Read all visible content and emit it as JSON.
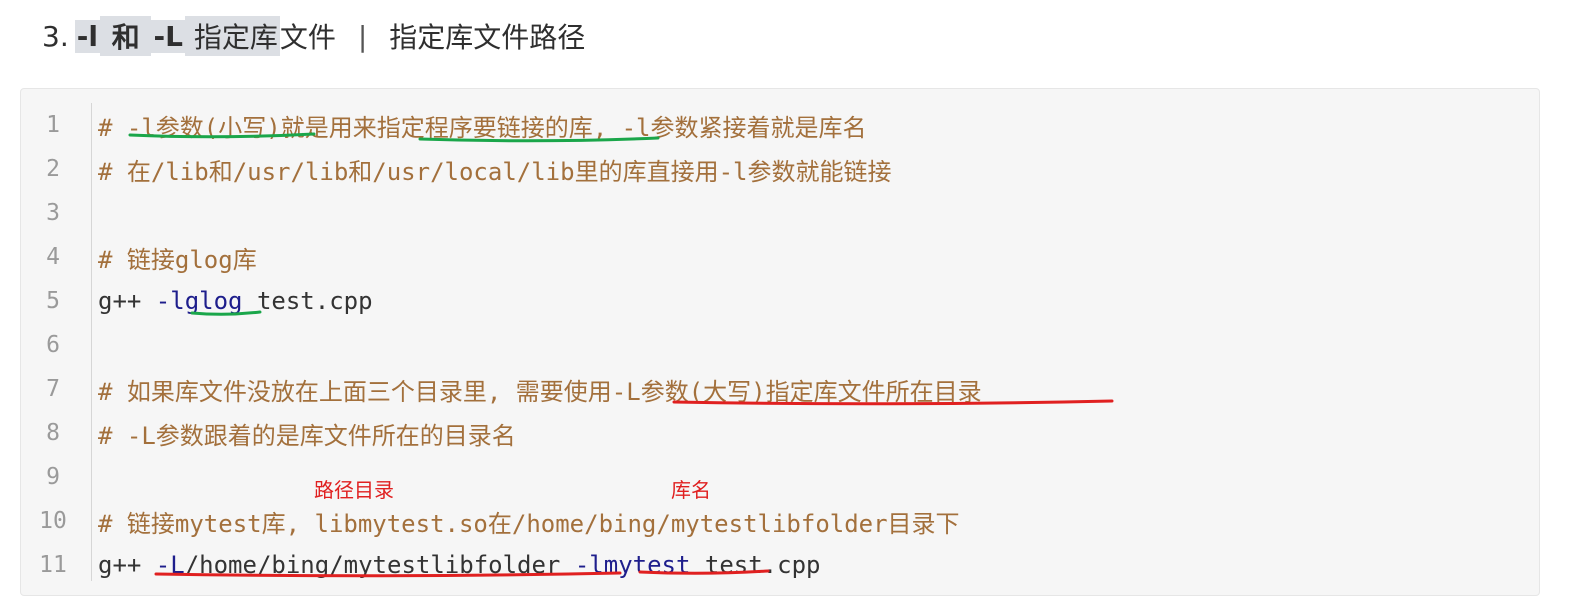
{
  "heading": {
    "number": "3.",
    "flag_l": "-l",
    "and": "和",
    "flag_L": "-L",
    "highlight_rest": "指定库",
    "title_part1": "文件",
    "separator": "|",
    "title_part2": "指定库文件路径"
  },
  "code": {
    "lines": [
      {
        "n": "1",
        "comment": "# -l参数(小写)就是用来指定程序要链接的库, -l参数紧接着就是库名"
      },
      {
        "n": "2",
        "comment": "# 在/lib和/usr/lib和/usr/local/lib里的库直接用-l参数就能链接"
      },
      {
        "n": "3",
        "comment": ""
      },
      {
        "n": "4",
        "comment": "# 链接glog库"
      },
      {
        "n": "5",
        "cmd": "g++ ",
        "flag": "-lglog",
        "rest": " test.cpp"
      },
      {
        "n": "6",
        "comment": ""
      },
      {
        "n": "7",
        "comment": "# 如果库文件没放在上面三个目录里, 需要使用-L参数(大写)指定库文件所在目录"
      },
      {
        "n": "8",
        "comment": "# -L参数跟着的是库文件所在的目录名"
      },
      {
        "n": "9",
        "comment": ""
      },
      {
        "n": "10",
        "comment": "# 链接mytest库, libmytest.so在/home/bing/mytestlibfolder目录下"
      },
      {
        "n": "11",
        "cmd": "g++ ",
        "flag": "-L",
        "path": "/home/bing/mytestlibfolder",
        "space": " ",
        "flag2": "-lmytest",
        "rest": " test.cpp"
      }
    ]
  },
  "annotations": {
    "path_dir": "路径目录",
    "lib_name": "库名",
    "green": "#1aa64a",
    "red": "#e02020"
  }
}
